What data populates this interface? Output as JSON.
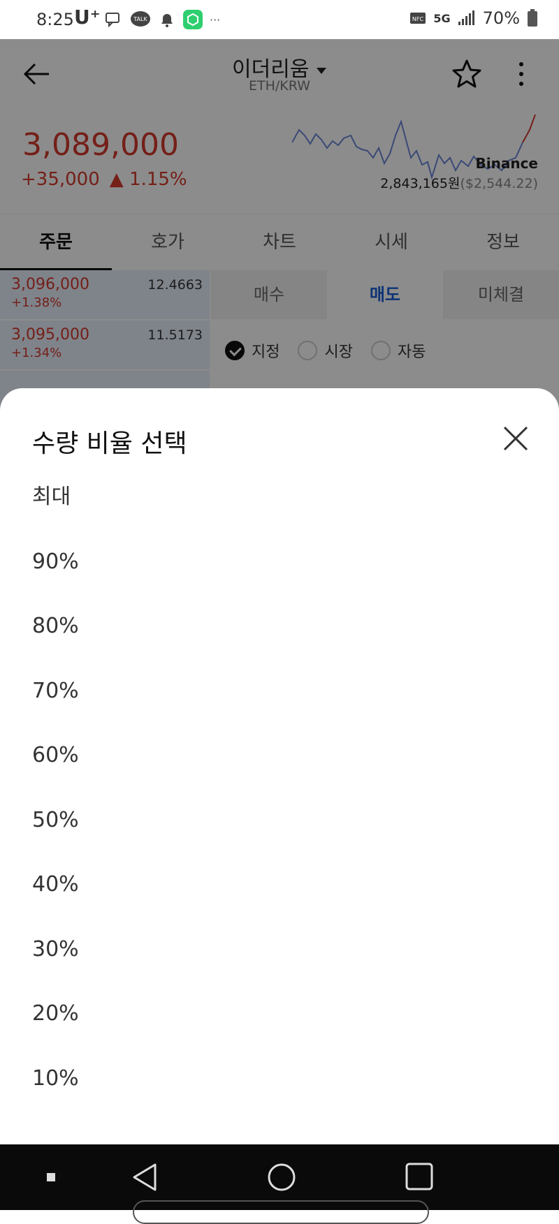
{
  "status_bar": {
    "time": "8:25",
    "carrier": "U⁺",
    "more": "···",
    "network": "5G",
    "battery": "70%"
  },
  "header": {
    "title": "이더리움",
    "pair": "ETH/KRW"
  },
  "ticker": {
    "price": "3,089,000",
    "change_amount": "+35,000",
    "change_pct": "▲ 1.15%",
    "exchange": "Binance",
    "exchange_price": "2,843,165원",
    "exchange_usd": "($2,544.22)"
  },
  "tabs": [
    {
      "label": "주문"
    },
    {
      "label": "호가"
    },
    {
      "label": "차트"
    },
    {
      "label": "시세"
    },
    {
      "label": "정보"
    }
  ],
  "orderbook": [
    {
      "price": "3,096,000",
      "pct": "+1.38%",
      "qty": "12.4663"
    },
    {
      "price": "3,095,000",
      "pct": "+1.34%",
      "qty": "11.5173"
    }
  ],
  "order_tabs": [
    {
      "label": "매수"
    },
    {
      "label": "매도"
    },
    {
      "label": "미체결"
    }
  ],
  "order_types": [
    {
      "label": "지정"
    },
    {
      "label": "시장"
    },
    {
      "label": "자동"
    }
  ],
  "sheet": {
    "title": "수량 비율 선택",
    "options": [
      {
        "label": "최대"
      },
      {
        "label": "90%"
      },
      {
        "label": "80%"
      },
      {
        "label": "70%"
      },
      {
        "label": "60%"
      },
      {
        "label": "50%"
      },
      {
        "label": "40%"
      },
      {
        "label": "30%"
      },
      {
        "label": "20%"
      },
      {
        "label": "10%"
      }
    ]
  },
  "colors": {
    "up": "#d33a2c",
    "accent": "#1a5ed8"
  }
}
